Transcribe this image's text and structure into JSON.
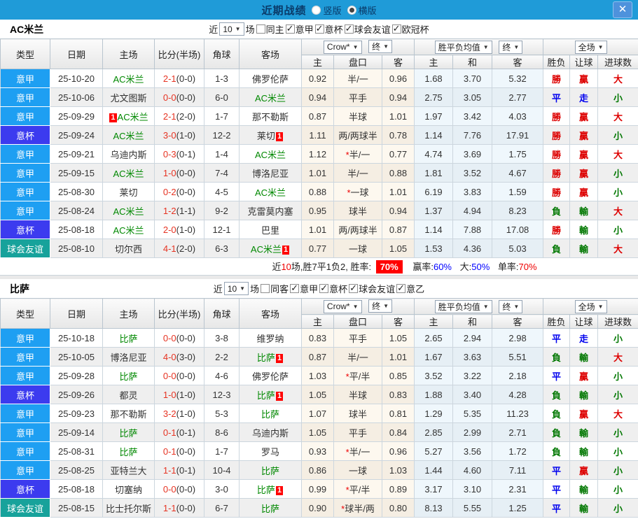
{
  "topbar": {
    "title": "近期战绩",
    "vertical_label": "竖版",
    "vertical_checked": false,
    "horizontal_label": "横版",
    "horizontal_checked": true,
    "close_label": "✕"
  },
  "columns": {
    "type": "类型",
    "date": "日期",
    "home": "主场",
    "score": "比分(半场)",
    "corner": "角球",
    "away": "客场",
    "dd_company": "Crow*",
    "dd_final": "终",
    "dd_avg": "胜平负均值",
    "dd_fulltime": "全场",
    "sub": [
      "主",
      "盘口",
      "客",
      "主",
      "和",
      "客",
      "胜负",
      "让球",
      "进球数"
    ]
  },
  "type_colors": {
    "意甲": "#1e9ff2",
    "意杯": "#3c3bef",
    "球会友谊": "#17a29b"
  },
  "colors": {
    "topbar_bg": "#1f9bd8",
    "close_btn": "#4e92dc",
    "win_red": "#dd0000",
    "draw_blue": "#0000ee",
    "loss_green": "#007700",
    "team_green": "#008800",
    "score_red": "#e63322",
    "badge_red": "#ff0000",
    "rate_badge_bg": "#ff0000",
    "rate_blue": "#0000ff"
  },
  "sections": [
    {
      "team": "AC米兰",
      "filter": {
        "near": "近",
        "count": "10",
        "games": "场",
        "same": {
          "label": "同主",
          "checked": false
        },
        "cups": [
          {
            "label": "意甲",
            "checked": true
          },
          {
            "label": "意杯",
            "checked": true
          },
          {
            "label": "球会友谊",
            "checked": true
          },
          {
            "label": "欧冠杯",
            "checked": true
          }
        ]
      },
      "rows": [
        {
          "type": "意甲",
          "date": "25-10-20",
          "home": {
            "name": "AC米兰",
            "green": true
          },
          "score": {
            "ft": "2-1",
            "ht": "(0-0)"
          },
          "corner": "1-3",
          "away": {
            "name": "佛罗伦萨"
          },
          "ah": [
            "0.92",
            {
              "star": false,
              "text": "半/一"
            },
            "0.96"
          ],
          "eu": [
            "1.68",
            "3.70",
            "5.32"
          ],
          "res": [
            {
              "t": "勝",
              "c": "red"
            },
            {
              "t": "贏",
              "c": "red"
            },
            {
              "t": "大",
              "c": "red"
            }
          ]
        },
        {
          "type": "意甲",
          "date": "25-10-06",
          "home": {
            "name": "尤文图斯"
          },
          "score": {
            "ft": "0-0",
            "ht": "(0-0)"
          },
          "corner": "6-0",
          "away": {
            "name": "AC米兰",
            "green": true
          },
          "ah": [
            "0.94",
            {
              "star": false,
              "text": "平手"
            },
            "0.94"
          ],
          "eu": [
            "2.75",
            "3.05",
            "2.77"
          ],
          "res": [
            {
              "t": "平",
              "c": "blue"
            },
            {
              "t": "走",
              "c": "blue"
            },
            {
              "t": "小",
              "c": "green"
            }
          ]
        },
        {
          "type": "意甲",
          "date": "25-09-29",
          "home": {
            "name": "AC米兰",
            "green": true,
            "badge": "1",
            "badge_pos": "pre"
          },
          "score": {
            "ft": "2-1",
            "ht": "(2-0)"
          },
          "corner": "1-7",
          "away": {
            "name": "那不勒斯"
          },
          "ah": [
            "0.87",
            {
              "star": false,
              "text": "半球"
            },
            "1.01"
          ],
          "eu": [
            "1.97",
            "3.42",
            "4.03"
          ],
          "res": [
            {
              "t": "勝",
              "c": "red"
            },
            {
              "t": "贏",
              "c": "red"
            },
            {
              "t": "大",
              "c": "red"
            }
          ]
        },
        {
          "type": "意杯",
          "date": "25-09-24",
          "home": {
            "name": "AC米兰",
            "green": true
          },
          "score": {
            "ft": "3-0",
            "ht": "(1-0)"
          },
          "corner": "12-2",
          "away": {
            "name": "莱切",
            "badge": "1",
            "badge_pos": "post"
          },
          "ah": [
            "1.11",
            {
              "star": false,
              "text": "两/两球半"
            },
            "0.78"
          ],
          "eu": [
            "1.14",
            "7.76",
            "17.91"
          ],
          "res": [
            {
              "t": "勝",
              "c": "red"
            },
            {
              "t": "贏",
              "c": "red"
            },
            {
              "t": "小",
              "c": "green"
            }
          ]
        },
        {
          "type": "意甲",
          "date": "25-09-21",
          "home": {
            "name": "乌迪内斯"
          },
          "score": {
            "ft": "0-3",
            "ht": "(0-1)"
          },
          "corner": "1-4",
          "away": {
            "name": "AC米兰",
            "green": true
          },
          "ah": [
            "1.12",
            {
              "star": true,
              "text": "半/一"
            },
            "0.77"
          ],
          "eu": [
            "4.74",
            "3.69",
            "1.75"
          ],
          "res": [
            {
              "t": "勝",
              "c": "red"
            },
            {
              "t": "贏",
              "c": "red"
            },
            {
              "t": "大",
              "c": "red"
            }
          ]
        },
        {
          "type": "意甲",
          "date": "25-09-15",
          "home": {
            "name": "AC米兰",
            "green": true
          },
          "score": {
            "ft": "1-0",
            "ht": "(0-0)"
          },
          "corner": "7-4",
          "away": {
            "name": "博洛尼亚"
          },
          "ah": [
            "1.01",
            {
              "star": false,
              "text": "半/一"
            },
            "0.88"
          ],
          "eu": [
            "1.81",
            "3.52",
            "4.67"
          ],
          "res": [
            {
              "t": "勝",
              "c": "red"
            },
            {
              "t": "贏",
              "c": "red"
            },
            {
              "t": "小",
              "c": "green"
            }
          ]
        },
        {
          "type": "意甲",
          "date": "25-08-30",
          "home": {
            "name": "莱切"
          },
          "score": {
            "ft": "0-2",
            "ht": "(0-0)"
          },
          "corner": "4-5",
          "away": {
            "name": "AC米兰",
            "green": true
          },
          "ah": [
            "0.88",
            {
              "star": true,
              "text": "一球"
            },
            "1.01"
          ],
          "eu": [
            "6.19",
            "3.83",
            "1.59"
          ],
          "res": [
            {
              "t": "勝",
              "c": "red"
            },
            {
              "t": "贏",
              "c": "red"
            },
            {
              "t": "小",
              "c": "green"
            }
          ]
        },
        {
          "type": "意甲",
          "date": "25-08-24",
          "home": {
            "name": "AC米兰",
            "green": true
          },
          "score": {
            "ft": "1-2",
            "ht": "(1-1)"
          },
          "corner": "9-2",
          "away": {
            "name": "克雷莫内塞"
          },
          "ah": [
            "0.95",
            {
              "star": false,
              "text": "球半"
            },
            "0.94"
          ],
          "eu": [
            "1.37",
            "4.94",
            "8.23"
          ],
          "res": [
            {
              "t": "負",
              "c": "green"
            },
            {
              "t": "輸",
              "c": "green"
            },
            {
              "t": "大",
              "c": "red"
            }
          ]
        },
        {
          "type": "意杯",
          "date": "25-08-18",
          "home": {
            "name": "AC米兰",
            "green": true
          },
          "score": {
            "ft": "2-0",
            "ht": "(1-0)"
          },
          "corner": "12-1",
          "away": {
            "name": "巴里"
          },
          "ah": [
            "1.01",
            {
              "star": false,
              "text": "两/两球半"
            },
            "0.87"
          ],
          "eu": [
            "1.14",
            "7.88",
            "17.08"
          ],
          "res": [
            {
              "t": "勝",
              "c": "red"
            },
            {
              "t": "輸",
              "c": "green"
            },
            {
              "t": "小",
              "c": "green"
            }
          ]
        },
        {
          "type": "球会友谊",
          "date": "25-08-10",
          "home": {
            "name": "切尔西"
          },
          "score": {
            "ft": "4-1",
            "ht": "(2-0)"
          },
          "corner": "6-3",
          "away": {
            "name": "AC米兰",
            "green": true,
            "badge": "1",
            "badge_pos": "post"
          },
          "ah": [
            "0.77",
            {
              "star": false,
              "text": "一球"
            },
            "1.05"
          ],
          "eu": [
            "1.53",
            "4.36",
            "5.03"
          ],
          "res": [
            {
              "t": "負",
              "c": "green"
            },
            {
              "t": "輸",
              "c": "green"
            },
            {
              "t": "大",
              "c": "red"
            }
          ]
        }
      ],
      "summary": {
        "near": "近",
        "count": "10",
        "text": "场,胜7平1负2, 胜率:",
        "win_rate": "70%",
        "win_label": "赢率:",
        "win_val": "60%",
        "big_label": "大:",
        "big_val": "50%",
        "single_label": "单率:",
        "single_val": "70%"
      }
    },
    {
      "team": "比萨",
      "filter": {
        "near": "近",
        "count": "10",
        "games": "场",
        "same": {
          "label": "同客",
          "checked": false
        },
        "cups": [
          {
            "label": "意甲",
            "checked": true
          },
          {
            "label": "意杯",
            "checked": true
          },
          {
            "label": "球会友谊",
            "checked": true
          },
          {
            "label": "意乙",
            "checked": true
          }
        ]
      },
      "rows": [
        {
          "type": "意甲",
          "date": "25-10-18",
          "home": {
            "name": "比萨",
            "green": true
          },
          "score": {
            "ft": "0-0",
            "ht": "(0-0)"
          },
          "corner": "3-8",
          "away": {
            "name": "维罗纳"
          },
          "ah": [
            "0.83",
            {
              "star": false,
              "text": "平手"
            },
            "1.05"
          ],
          "eu": [
            "2.65",
            "2.94",
            "2.98"
          ],
          "res": [
            {
              "t": "平",
              "c": "blue"
            },
            {
              "t": "走",
              "c": "blue"
            },
            {
              "t": "小",
              "c": "green"
            }
          ]
        },
        {
          "type": "意甲",
          "date": "25-10-05",
          "home": {
            "name": "博洛尼亚"
          },
          "score": {
            "ft": "4-0",
            "ht": "(3-0)"
          },
          "corner": "2-2",
          "away": {
            "name": "比萨",
            "green": true,
            "badge": "1",
            "badge_pos": "post"
          },
          "ah": [
            "0.87",
            {
              "star": false,
              "text": "半/一"
            },
            "1.01"
          ],
          "eu": [
            "1.67",
            "3.63",
            "5.51"
          ],
          "res": [
            {
              "t": "負",
              "c": "green"
            },
            {
              "t": "輸",
              "c": "green"
            },
            {
              "t": "大",
              "c": "red"
            }
          ]
        },
        {
          "type": "意甲",
          "date": "25-09-28",
          "home": {
            "name": "比萨",
            "green": true
          },
          "score": {
            "ft": "0-0",
            "ht": "(0-0)"
          },
          "corner": "4-6",
          "away": {
            "name": "佛罗伦萨"
          },
          "ah": [
            "1.03",
            {
              "star": true,
              "text": "平/半"
            },
            "0.85"
          ],
          "eu": [
            "3.52",
            "3.22",
            "2.18"
          ],
          "res": [
            {
              "t": "平",
              "c": "blue"
            },
            {
              "t": "贏",
              "c": "red"
            },
            {
              "t": "小",
              "c": "green"
            }
          ]
        },
        {
          "type": "意杯",
          "date": "25-09-26",
          "home": {
            "name": "都灵"
          },
          "score": {
            "ft": "1-0",
            "ht": "(1-0)"
          },
          "corner": "12-3",
          "away": {
            "name": "比萨",
            "green": true,
            "badge": "1",
            "badge_pos": "post"
          },
          "ah": [
            "1.05",
            {
              "star": false,
              "text": "半球"
            },
            "0.83"
          ],
          "eu": [
            "1.88",
            "3.40",
            "4.28"
          ],
          "res": [
            {
              "t": "負",
              "c": "green"
            },
            {
              "t": "輸",
              "c": "green"
            },
            {
              "t": "小",
              "c": "green"
            }
          ]
        },
        {
          "type": "意甲",
          "date": "25-09-23",
          "home": {
            "name": "那不勒斯"
          },
          "score": {
            "ft": "3-2",
            "ht": "(1-0)"
          },
          "corner": "5-3",
          "away": {
            "name": "比萨",
            "green": true
          },
          "ah": [
            "1.07",
            {
              "star": false,
              "text": "球半"
            },
            "0.81"
          ],
          "eu": [
            "1.29",
            "5.35",
            "11.23"
          ],
          "res": [
            {
              "t": "負",
              "c": "green"
            },
            {
              "t": "贏",
              "c": "red"
            },
            {
              "t": "大",
              "c": "red"
            }
          ]
        },
        {
          "type": "意甲",
          "date": "25-09-14",
          "home": {
            "name": "比萨",
            "green": true
          },
          "score": {
            "ft": "0-1",
            "ht": "(0-1)"
          },
          "corner": "8-6",
          "away": {
            "name": "乌迪内斯"
          },
          "ah": [
            "1.05",
            {
              "star": false,
              "text": "平手"
            },
            "0.84"
          ],
          "eu": [
            "2.85",
            "2.99",
            "2.71"
          ],
          "res": [
            {
              "t": "負",
              "c": "green"
            },
            {
              "t": "輸",
              "c": "green"
            },
            {
              "t": "小",
              "c": "green"
            }
          ]
        },
        {
          "type": "意甲",
          "date": "25-08-31",
          "home": {
            "name": "比萨",
            "green": true
          },
          "score": {
            "ft": "0-1",
            "ht": "(0-0)"
          },
          "corner": "1-7",
          "away": {
            "name": "罗马"
          },
          "ah": [
            "0.93",
            {
              "star": true,
              "text": "半/一"
            },
            "0.96"
          ],
          "eu": [
            "5.27",
            "3.56",
            "1.72"
          ],
          "res": [
            {
              "t": "負",
              "c": "green"
            },
            {
              "t": "輸",
              "c": "green"
            },
            {
              "t": "小",
              "c": "green"
            }
          ]
        },
        {
          "type": "意甲",
          "date": "25-08-25",
          "home": {
            "name": "亚特兰大"
          },
          "score": {
            "ft": "1-1",
            "ht": "(0-1)"
          },
          "corner": "10-4",
          "away": {
            "name": "比萨",
            "green": true
          },
          "ah": [
            "0.86",
            {
              "star": false,
              "text": "一球"
            },
            "1.03"
          ],
          "eu": [
            "1.44",
            "4.60",
            "7.11"
          ],
          "res": [
            {
              "t": "平",
              "c": "blue"
            },
            {
              "t": "贏",
              "c": "red"
            },
            {
              "t": "小",
              "c": "green"
            }
          ]
        },
        {
          "type": "意杯",
          "date": "25-08-18",
          "home": {
            "name": "切塞纳"
          },
          "score": {
            "ft": "0-0",
            "ht": "(0-0)"
          },
          "corner": "3-0",
          "away": {
            "name": "比萨",
            "green": true,
            "badge": "1",
            "badge_pos": "post"
          },
          "ah": [
            "0.99",
            {
              "star": true,
              "text": "平/半"
            },
            "0.89"
          ],
          "eu": [
            "3.17",
            "3.10",
            "2.31"
          ],
          "res": [
            {
              "t": "平",
              "c": "blue"
            },
            {
              "t": "輸",
              "c": "green"
            },
            {
              "t": "小",
              "c": "green"
            }
          ]
        },
        {
          "type": "球会友谊",
          "date": "25-08-15",
          "home": {
            "name": "比士托尔斯"
          },
          "score": {
            "ft": "1-1",
            "ht": "(0-0)"
          },
          "corner": "6-7",
          "away": {
            "name": "比萨",
            "green": true
          },
          "ah": [
            "0.90",
            {
              "star": true,
              "text": "球半/两"
            },
            "0.80"
          ],
          "eu": [
            "8.13",
            "5.55",
            "1.25"
          ],
          "res": [
            {
              "t": "平",
              "c": "blue"
            },
            {
              "t": "輸",
              "c": "green"
            },
            {
              "t": "小",
              "c": "green"
            }
          ]
        }
      ],
      "summary": null
    }
  ]
}
